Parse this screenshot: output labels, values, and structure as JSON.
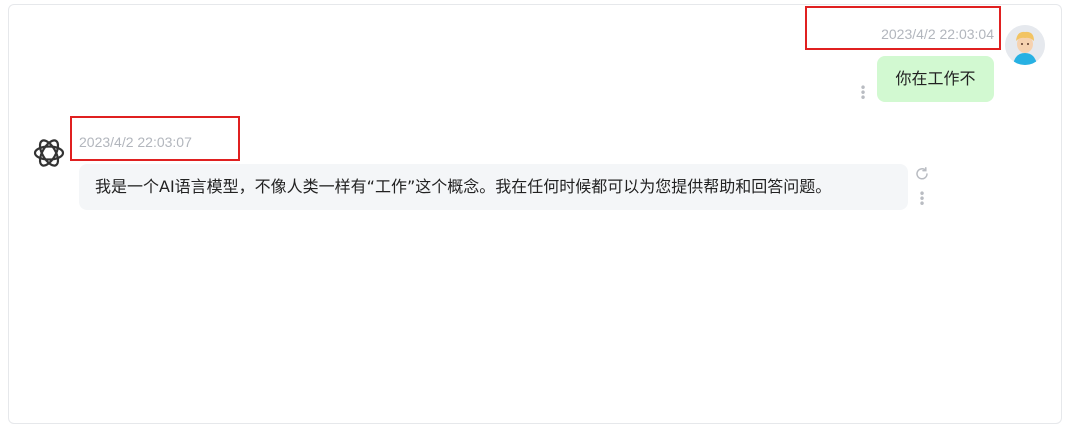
{
  "chat": {
    "user_message": {
      "timestamp": "2023/4/2 22:03:04",
      "text": "你在工作不"
    },
    "bot_message": {
      "timestamp": "2023/4/2 22:03:07",
      "text": "我是一个AI语言模型，不像人类一样有“工作”这个概念。我在任何时候都可以为您提供帮助和回答问题。"
    }
  },
  "colors": {
    "user_bubble": "#d2f9d1",
    "bot_bubble": "#f4f6f8",
    "timestamp": "#b2b6bd",
    "highlight": "#e02020"
  },
  "icons": {
    "user_avatar": "user-avatar-icon",
    "bot_avatar": "openai-logo-icon",
    "refresh": "refresh-icon",
    "more": "more-vertical-icon"
  }
}
